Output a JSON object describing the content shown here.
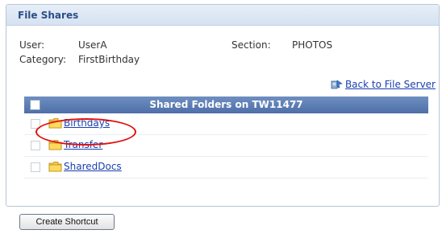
{
  "panel": {
    "title": "File Shares"
  },
  "info": {
    "user_label": "User:",
    "user_value": "UserA",
    "section_label": "Section:",
    "section_value": "PHOTOS",
    "category_label": "Category:",
    "category_value": "FirstBirthday"
  },
  "back_link": {
    "label": "Back to File Server",
    "icon": "server-icon"
  },
  "table": {
    "header": "Shared Folders on TW11477",
    "rows": [
      {
        "name": "Birthdays",
        "icon": "folder-icon",
        "highlighted": true
      },
      {
        "name": "Transfer",
        "icon": "folder-icon"
      },
      {
        "name": "SharedDocs",
        "icon": "folder-icon"
      }
    ]
  },
  "actions": {
    "create_shortcut": "Create Shortcut"
  },
  "colors": {
    "header_bg": "#4e6fa8",
    "link": "#1a3fb0",
    "highlight": "#e01010"
  }
}
